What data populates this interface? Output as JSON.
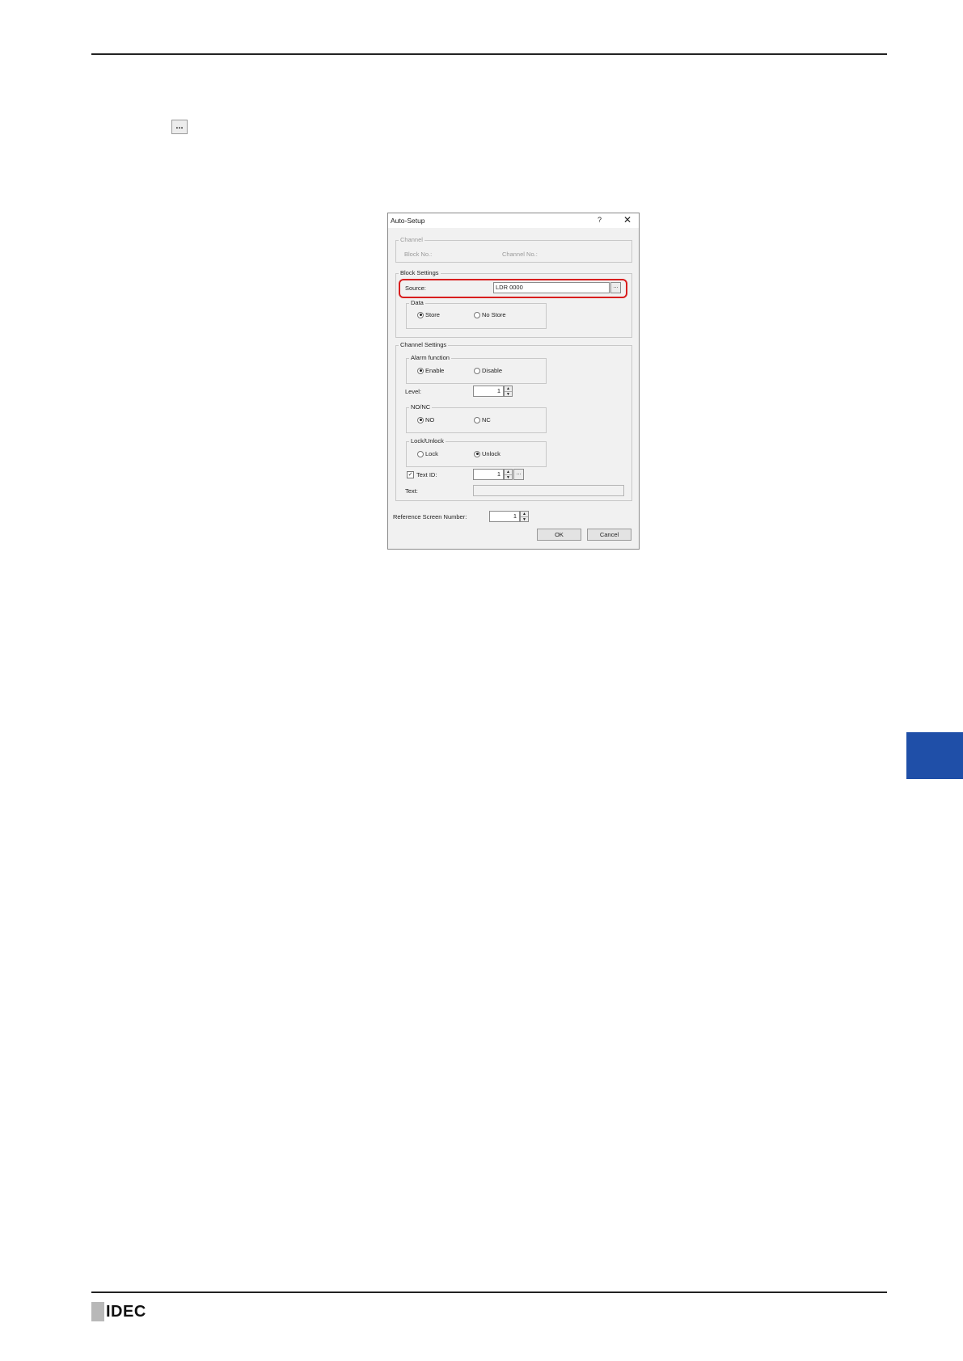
{
  "page": {
    "inline_button_label": "...",
    "brand": "IDEC"
  },
  "dialog": {
    "title": "Auto-Setup",
    "help": "?",
    "close": "✕",
    "channel": {
      "legend": "Channel",
      "block_no_label": "Block No.:",
      "channel_no_label": "Channel No.:"
    },
    "block_settings": {
      "legend": "Block Settings",
      "source_label": "Source:",
      "source_value": "LDR 0000",
      "browse_label": "...",
      "data": {
        "legend": "Data",
        "options": [
          "Store",
          "No Store"
        ],
        "selected": "Store"
      }
    },
    "channel_settings": {
      "legend": "Channel Settings",
      "alarm_function": {
        "legend": "Alarm function",
        "options": [
          "Enable",
          "Disable"
        ],
        "selected": "Enable"
      },
      "level_label": "Level:",
      "level_value": "1",
      "no_nc": {
        "legend": "NO/NC",
        "options": [
          "NO",
          "NC"
        ],
        "selected": "NO"
      },
      "lock_unlock": {
        "legend": "Lock/Unlock",
        "options": [
          "Lock",
          "Unlock"
        ],
        "selected": "Unlock"
      },
      "text_id_label": "Text ID:",
      "text_id_checked": true,
      "text_id_value": "1",
      "text_id_browse": "...",
      "text_label": "Text:",
      "text_value": ""
    },
    "reference_screen_label": "Reference Screen Number:",
    "reference_screen_value": "1",
    "ok_label": "OK",
    "cancel_label": "Cancel"
  },
  "colors": {
    "highlight": "#d81e1e",
    "side_tab": "#1f4fa8"
  }
}
